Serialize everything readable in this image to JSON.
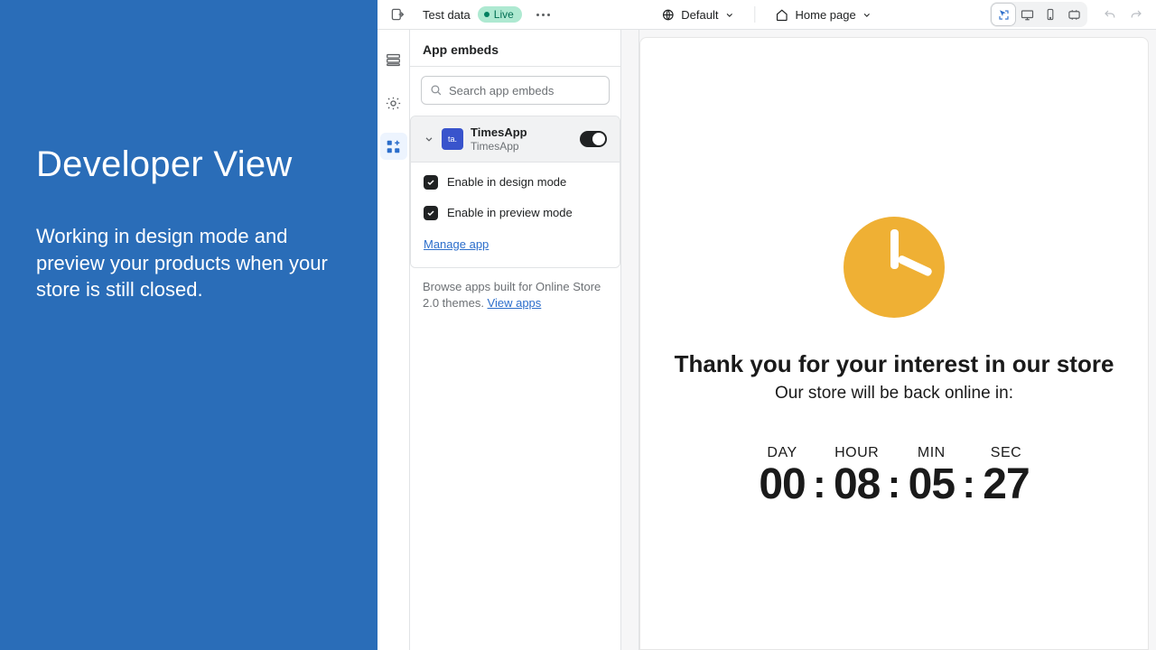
{
  "promo": {
    "title": "Developer View",
    "subtitle": "Working in design mode and preview your products when your store is still closed."
  },
  "topbar": {
    "test_data_label": "Test data",
    "live_badge": "Live",
    "default_selector": "Default",
    "home_selector": "Home page"
  },
  "panel": {
    "title": "App embeds",
    "search_placeholder": "Search app embeds",
    "app": {
      "title": "TimesApp",
      "subtitle": "TimesApp",
      "icon_letters": "ta.",
      "option_design": "Enable in design mode",
      "option_preview": "Enable in preview mode",
      "manage_link": "Manage app"
    },
    "browse_text": "Browse apps built for Online Store 2.0 themes. ",
    "browse_link": "View apps"
  },
  "preview": {
    "heading": "Thank you for your interest in our store",
    "subheading": "Our store will be back online in:",
    "labels": {
      "day": "DAY",
      "hour": "HOUR",
      "min": "MIN",
      "sec": "SEC"
    },
    "values": {
      "day": "00",
      "hour": "08",
      "min": "05",
      "sec": "27"
    }
  }
}
